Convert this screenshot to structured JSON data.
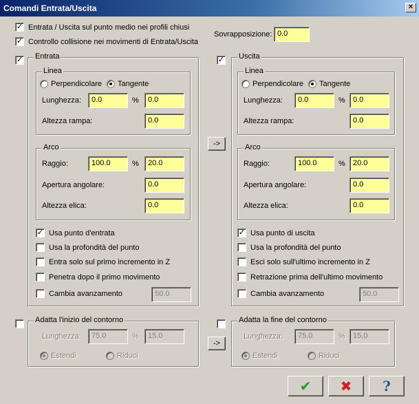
{
  "window": {
    "title": "Comandi Entrata/Uscita"
  },
  "top": {
    "midpoint_label": "Entrata / Uscita sul punto medio nei profili chiusi",
    "collision_label": "Controllo collisione nei movimenti di Entrata/Uscita",
    "overlap_label": "Sovrapposizione:",
    "overlap_value": "0.0"
  },
  "entry": {
    "title": "Entrata",
    "line": {
      "title": "Linea",
      "perpendicular": "Perpendicolare",
      "tangent": "Tangente",
      "length_label": "Lunghezza:",
      "length_value": "0.0",
      "percent": "%",
      "percent_value": "0.0",
      "ramp_label": "Altezza rampa:",
      "ramp_value": "0.0"
    },
    "arc": {
      "title": "Arco",
      "radius_label": "Raggio:",
      "radius_value": "100.0",
      "percent": "%",
      "percent_value": "20.0",
      "angle_label": "Apertura angolare:",
      "angle_value": "0.0",
      "helix_label": "Altezza elica:",
      "helix_value": "0.0"
    },
    "use_point": "Usa punto d'entrata",
    "use_depth": "Usa la profondità del punto",
    "first_z": "Entra solo sul primo incremento in Z",
    "penetrate": "Penetra dopo il primo movimento",
    "change_feed": "Cambia avanzamento",
    "feed_value": "50.0"
  },
  "exit": {
    "title": "Uscita",
    "line": {
      "title": "Linea",
      "perpendicular": "Perpendicolare",
      "tangent": "Tangente",
      "length_label": "Lunghezza:",
      "length_value": "0.0",
      "percent": "%",
      "percent_value": "0.0",
      "ramp_label": "Altezza rampa:",
      "ramp_value": "0.0"
    },
    "arc": {
      "title": "Arco",
      "radius_label": "Raggio:",
      "radius_value": "100.0",
      "percent": "%",
      "percent_value": "20.0",
      "angle_label": "Apertura angolare:",
      "angle_value": "0.0",
      "helix_label": "Altezza elica:",
      "helix_value": "0.0"
    },
    "use_point": "Usa punto di uscita",
    "use_depth": "Usa la profondità del punto",
    "last_z": "Esci solo sull'ultimo incremento in Z",
    "retract": "Retrazione prima dell'ultimo movimento",
    "change_feed": "Cambia avanzamento",
    "feed_value": "50.0"
  },
  "adjust_start": {
    "title": "Adatta l'inizio del contorno",
    "length_label": "Lunghezza:",
    "length_value": "75.0",
    "percent": "%",
    "percent_value": "15.0",
    "extend": "Estendi",
    "reduce": "Riduci"
  },
  "adjust_end": {
    "title": "Adatta la fine del contorno",
    "length_label": "Lunghezza:",
    "length_value": "75.0",
    "percent": "%",
    "percent_value": "15.0",
    "extend": "Estendi",
    "reduce": "Riduci"
  },
  "copy_button": "->",
  "copy_button_2": "->",
  "colors": {
    "field": "#ffff99",
    "ok": "#2a9a2a",
    "cancel": "#d42020",
    "help": "#3050a0"
  },
  "icons": {
    "ok": "check-icon",
    "cancel": "cross-icon",
    "help": "question-icon"
  },
  "glyphs": {
    "check": "✔",
    "cross": "✖",
    "question": "?",
    "tick": "✓",
    "close": "×"
  }
}
